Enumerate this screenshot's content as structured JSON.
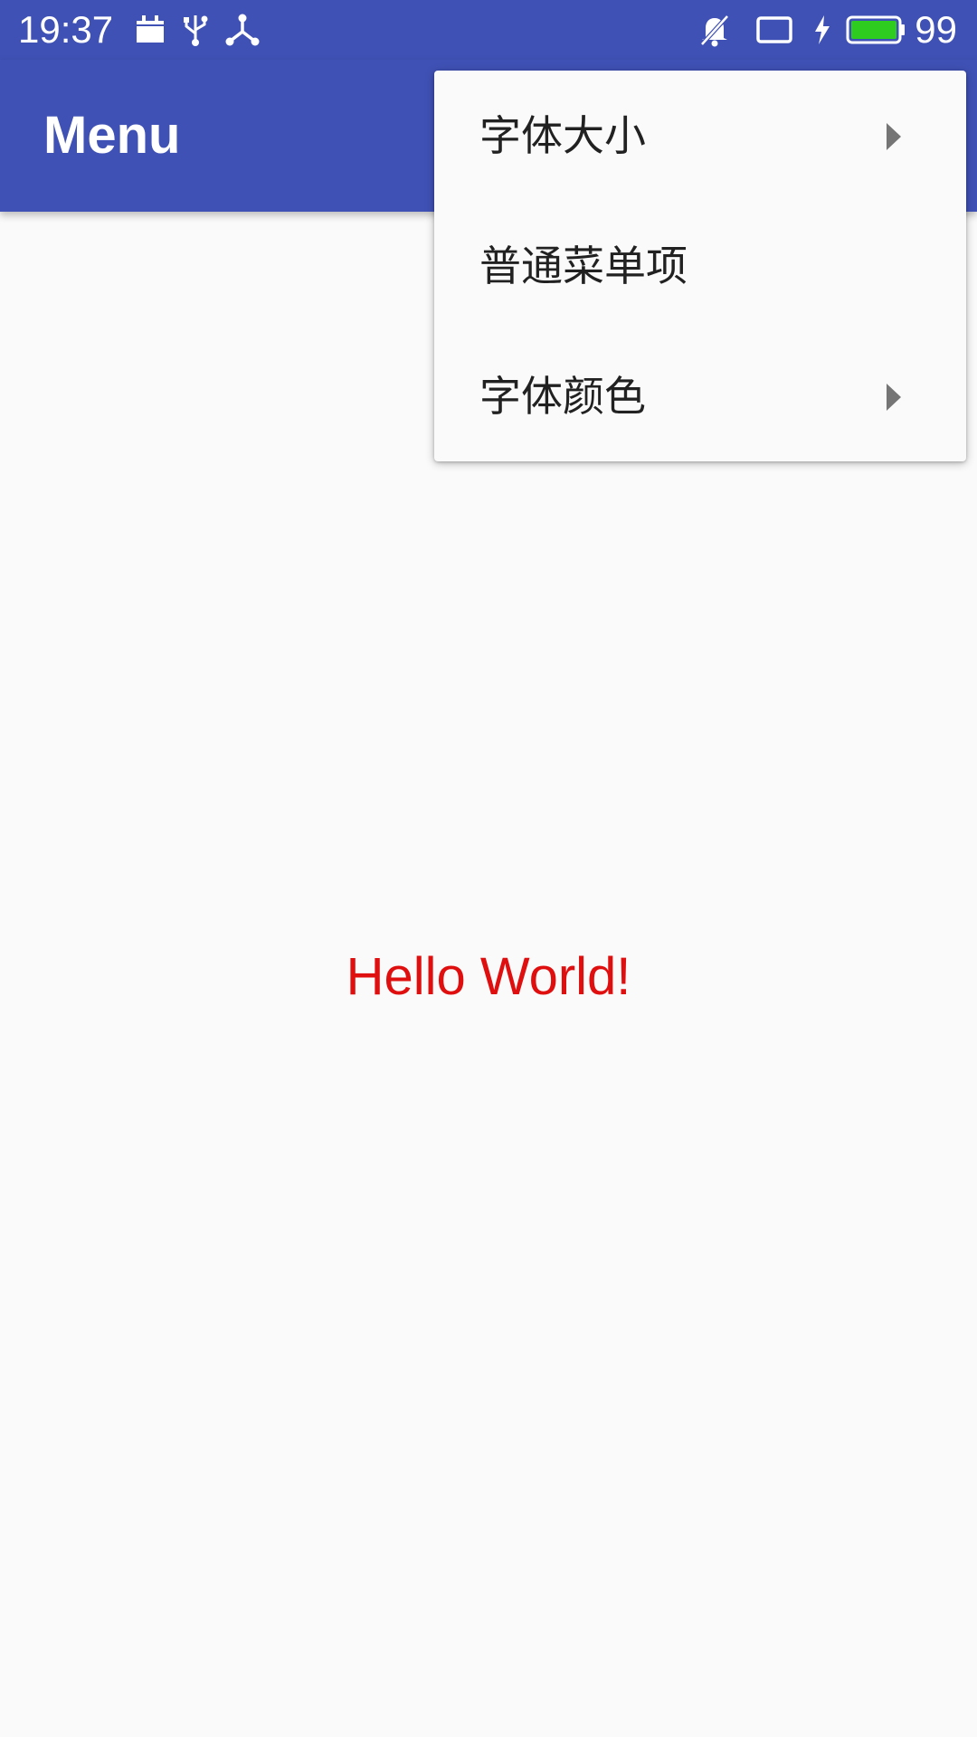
{
  "status_bar": {
    "time": "19:37",
    "battery_level": "99",
    "icons": [
      "calendar-icon",
      "usb-icon",
      "network-share-icon",
      "notifications-off-icon",
      "tablet-icon",
      "charging-icon",
      "battery-icon"
    ],
    "battery_color": "#2ecc1f"
  },
  "app_bar": {
    "title": "Menu",
    "color": "#3f51b5"
  },
  "content": {
    "hello_text": "Hello World!",
    "hello_color": "#e00f0f"
  },
  "popup_menu": {
    "items": [
      {
        "label": "字体大小",
        "has_submenu": true
      },
      {
        "label": "普通菜单项",
        "has_submenu": false
      },
      {
        "label": "字体颜色",
        "has_submenu": true
      }
    ]
  }
}
